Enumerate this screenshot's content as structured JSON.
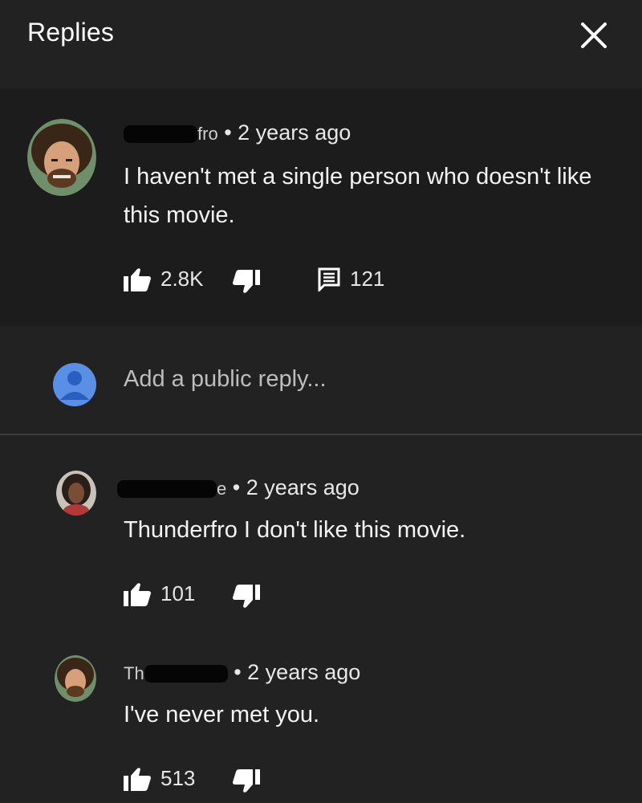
{
  "header": {
    "title": "Replies",
    "close_icon": "close-icon"
  },
  "main_comment": {
    "author_visible_suffix": "fro",
    "time": "• 2 years ago",
    "text_line1": "I haven't met a single person who doesn't like",
    "text_line2": "this movie.",
    "likes": "2.8K",
    "replies": "121"
  },
  "reply_box": {
    "placeholder": "Add a public reply..."
  },
  "replies": [
    {
      "author_visible_suffix": "e",
      "time": "• 2 years ago",
      "text": "Thunderfro I don't like this movie.",
      "likes": "101"
    },
    {
      "author_visible_prefix": "Th",
      "time": "• 2 years ago",
      "text": "I've never met you.",
      "likes": "513"
    }
  ],
  "colors": {
    "background": "#222222",
    "comment_highlight": "#1c1c1c",
    "text": "#f1f1f1",
    "avatar_blue": "#5a8fe6"
  }
}
